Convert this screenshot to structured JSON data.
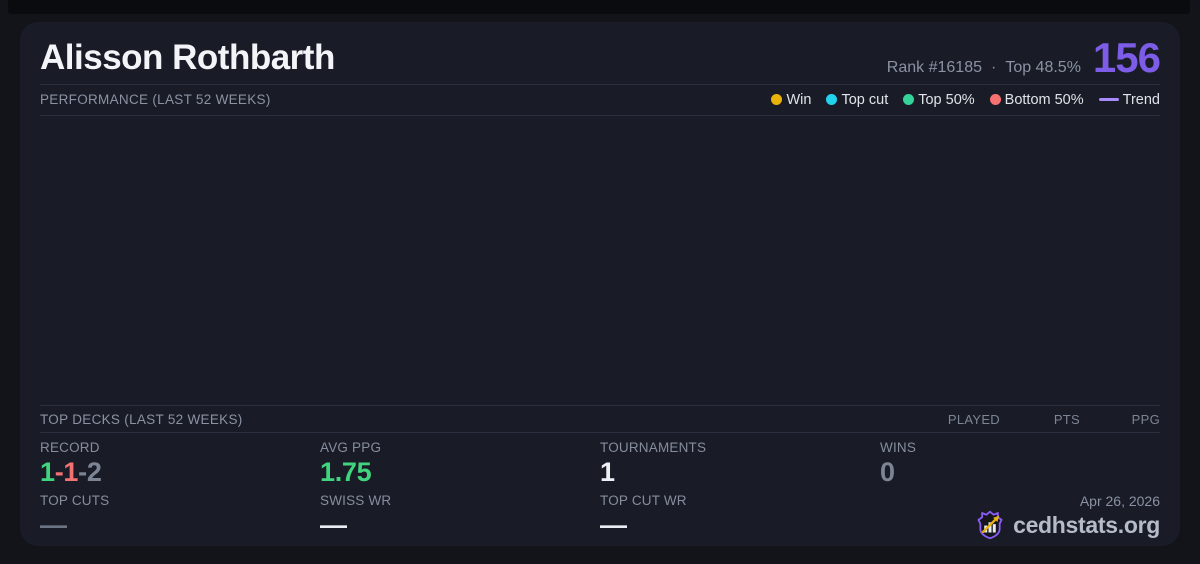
{
  "header": {
    "player_name": "Alisson Rothbarth",
    "rank": "Rank #16185",
    "dot_separator": "·",
    "top_percent": "Top 48.5%",
    "score": "156",
    "score_color": "#7d5ce8"
  },
  "performance": {
    "section_title": "PERFORMANCE (LAST 52 WEEKS)",
    "legend": {
      "win": {
        "label": "Win",
        "color": "#eab308"
      },
      "top_cut": {
        "label": "Top cut",
        "color": "#22d3ee"
      },
      "top_50": {
        "label": "Top 50%",
        "color": "#34d399"
      },
      "bottom_50": {
        "label": "Bottom 50%",
        "color": "#f87171"
      },
      "trend": {
        "label": "Trend",
        "color": "#a78bfa"
      }
    }
  },
  "chart_data": {
    "type": "scatter",
    "title": "PERFORMANCE (LAST 52 WEEKS)",
    "x": [],
    "series": [
      {
        "name": "Win",
        "values": []
      },
      {
        "name": "Top cut",
        "values": []
      },
      {
        "name": "Top 50%",
        "values": []
      },
      {
        "name": "Bottom 50%",
        "values": []
      },
      {
        "name": "Trend",
        "values": []
      }
    ],
    "legend_position": "top-right",
    "grid": false,
    "note": "chart plot area is empty in the screenshot — no points or trend line rendered"
  },
  "top_decks": {
    "section_title": "TOP DECKS (LAST 52 WEEKS)",
    "columns": [
      "PLAYED",
      "PTS",
      "PPG"
    ],
    "rows": []
  },
  "stats": {
    "record": {
      "label": "RECORD",
      "wins": "1",
      "losses": "-1",
      "draws": "-2",
      "win_color": "#41d47e",
      "loss_color": "#f27171",
      "draw_color": "#7d8595"
    },
    "avg_ppg": {
      "label": "AVG PPG",
      "value": "1.75",
      "color": "#41d47e"
    },
    "tournaments": {
      "label": "TOURNAMENTS",
      "value": "1",
      "color": "#eef0f4"
    },
    "wins": {
      "label": "WINS",
      "value": "0",
      "color": "#7d8595"
    },
    "top_cuts": {
      "label": "TOP CUTS",
      "value": "—",
      "color": "#6d7585"
    },
    "swiss_wr": {
      "label": "SWISS WR",
      "value": "—",
      "color": "#e9ecf2"
    },
    "top_cut_wr": {
      "label": "TOP CUT WR",
      "value": "—",
      "color": "#e9ecf2"
    }
  },
  "footer": {
    "date": "Apr 26, 2026",
    "site_name": "cedhstats.org",
    "logo": "cedhstats-shield-logo",
    "logo_colors": {
      "outline": "#8b5cf6",
      "bars": "#e8eaf0",
      "arrow": "#eab308"
    }
  },
  "colors": {
    "page_bg": "#13141a",
    "card_bg": "#191c26",
    "divider": "#2b3040",
    "muted_text": "#8b92a3",
    "accent_purple": "#7d5ce8"
  }
}
